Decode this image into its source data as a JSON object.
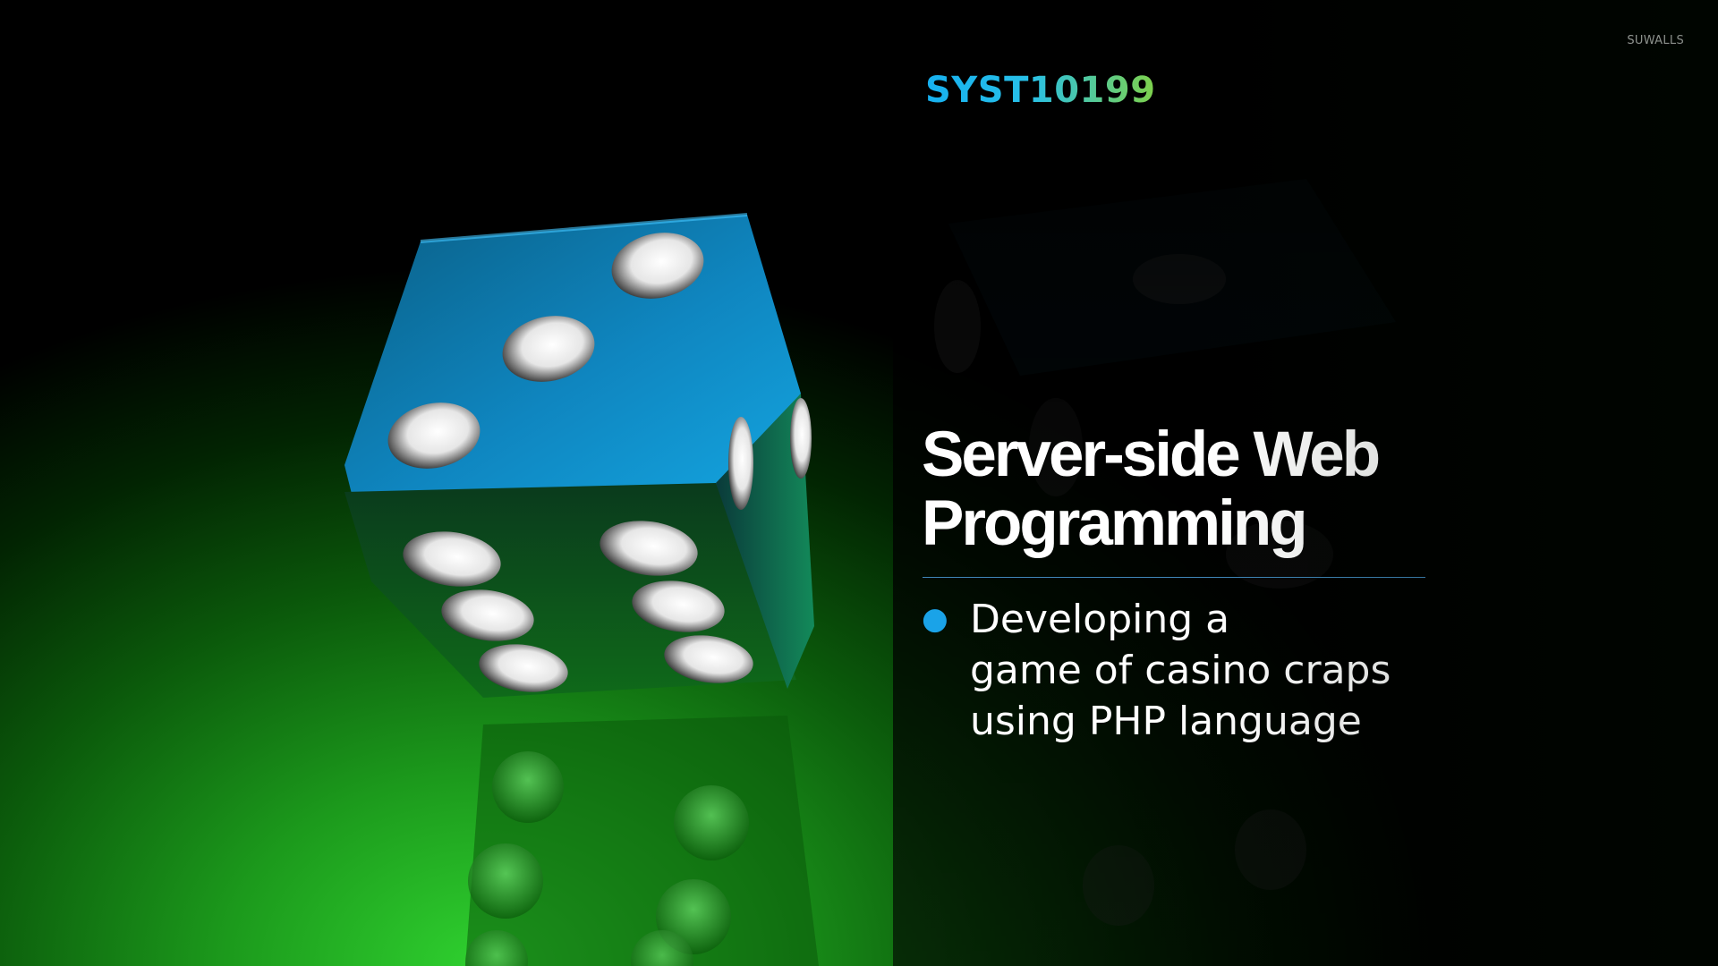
{
  "watermark": "SUWALLS",
  "slide": {
    "course_code": "SYST10199",
    "title_lines": [
      "Server-side Web",
      "Programming"
    ],
    "bullets": [
      {
        "lines": [
          "Developing a",
          "game of casino craps",
          "using PHP language"
        ]
      }
    ]
  },
  "colors": {
    "course_code_start": "#16b0f0",
    "course_code_end": "#7fd24a",
    "bullet": "#1aa3e8",
    "rule": "#3f86b8",
    "background_glow": "#2fd02f"
  },
  "image": {
    "description_icon": "dice-icon"
  }
}
